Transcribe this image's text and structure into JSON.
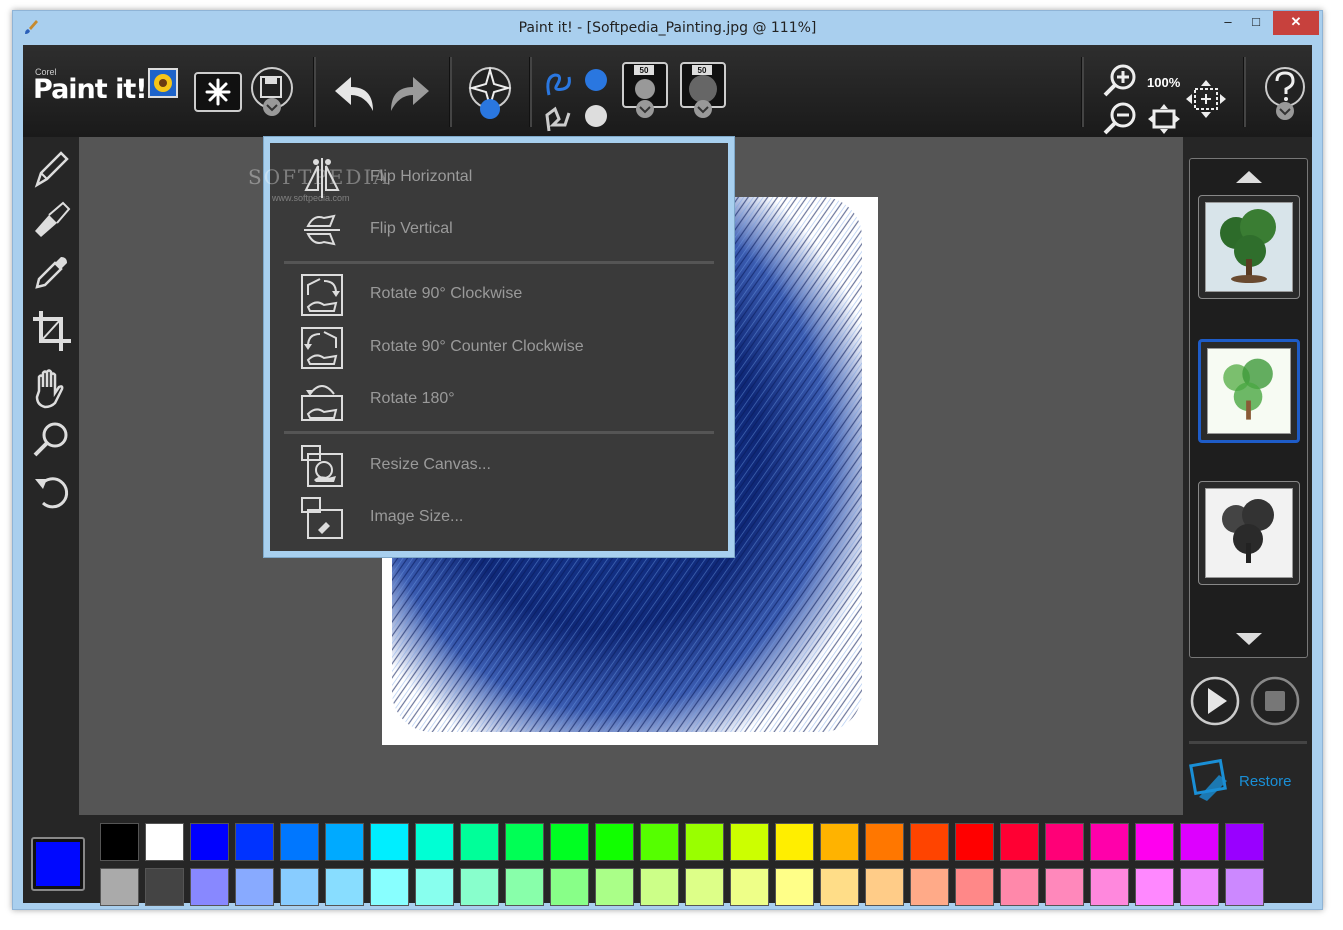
{
  "window": {
    "title": "Paint it! - [Softpedia_Painting.jpg @ 111%]",
    "min_glyph": "–",
    "max_glyph": "□",
    "close_glyph": "✕"
  },
  "toolbar": {
    "logo_brand": "Corel",
    "logo_name": "Paint it!",
    "zoom": "100%",
    "brush_size_1": "50",
    "brush_size_2": "50"
  },
  "menu": {
    "items": [
      {
        "label": "Flip Horizontal"
      },
      {
        "label": "Flip Vertical"
      },
      {
        "label": "Rotate 90° Clockwise"
      },
      {
        "label": "Rotate 90° Counter Clockwise"
      },
      {
        "label": "Rotate 180°"
      },
      {
        "label": "Resize Canvas..."
      },
      {
        "label": "Image Size..."
      }
    ],
    "watermark": "SOFTPEDIA",
    "watermark_url": "www.softpedia.com"
  },
  "right_panel": {
    "restore_label": "Restore"
  },
  "palette": {
    "current": "#0008ff",
    "row1": [
      "#000000",
      "#ffffff",
      "#0000ff",
      "#0033ff",
      "#0077ff",
      "#00aaff",
      "#00eeff",
      "#00ffd4",
      "#00ff99",
      "#00ff55",
      "#00ff22",
      "#11ff00",
      "#55ff00",
      "#99ff00",
      "#ccff00",
      "#ffee00",
      "#ffb300",
      "#ff7700",
      "#ff4400",
      "#ff0000",
      "#ff0033",
      "#ff0077",
      "#ff00aa",
      "#ff00ee",
      "#dd00ff",
      "#9900ff"
    ],
    "row2": [
      "#aaaaaa",
      "#444444",
      "#8888ff",
      "#88aaff",
      "#88ccff",
      "#88ddff",
      "#88ffff",
      "#88ffee",
      "#88ffcc",
      "#88ffaa",
      "#88ff88",
      "#aaff88",
      "#ccff88",
      "#ddff88",
      "#eeff88",
      "#ffff88",
      "#ffdd88",
      "#ffcc88",
      "#ffaa88",
      "#ff8888",
      "#ff88aa",
      "#ff88bb",
      "#ff88dd",
      "#ff88ff",
      "#ee88ff",
      "#cc88ff"
    ]
  }
}
